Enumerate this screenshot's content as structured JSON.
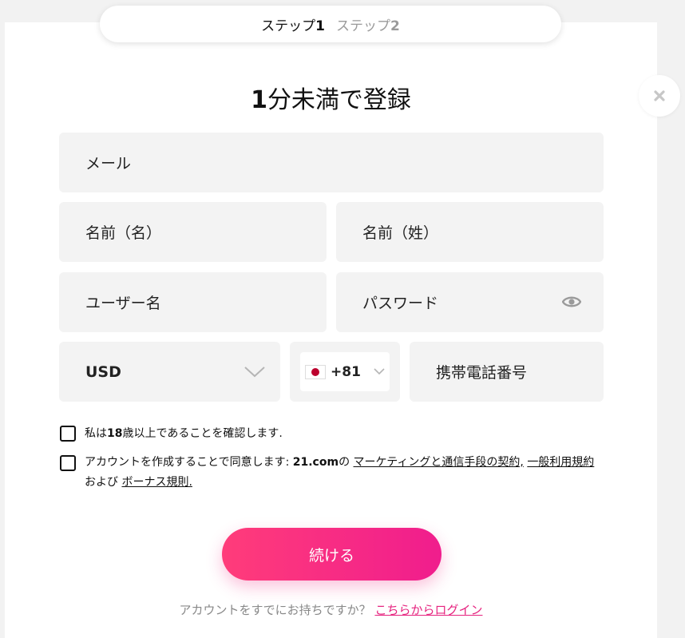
{
  "steps": {
    "step1_label": "ステップ",
    "step1_num": "1",
    "step2_label": "ステップ",
    "step2_num": "2"
  },
  "title": {
    "num": "1",
    "text": "分未満で登録"
  },
  "fields": {
    "email_placeholder": "メール",
    "first_name_placeholder": "名前（名）",
    "last_name_placeholder": "名前（姓）",
    "username_placeholder": "ユーザー名",
    "password_placeholder": "パスワード",
    "currency_value": "USD",
    "country_code": "+81",
    "phone_placeholder": "携帯電話番号"
  },
  "checkboxes": {
    "age_pre": "私は",
    "age_num": "18",
    "age_post": "歳以上であることを確認します.",
    "terms_pre": "アカウントを作成することで同意します: ",
    "terms_brand": "21.com",
    "terms_no": "の ",
    "terms_link1": "マーケティングと通信手段の契約,",
    "terms_link2": "一般利用規約",
    "terms_and": " および ",
    "terms_link3": "ボーナス規則."
  },
  "continue_button": "続ける",
  "login": {
    "prompt": "アカウントをすでにお持ちですか？ ",
    "link": "こちらからログイン"
  },
  "colors": {
    "accent": "#f01d8d",
    "field_bg": "#f3f3f3"
  },
  "icons": {
    "close": "close-icon",
    "eye": "eye-icon",
    "chevron": "chevron-down-icon",
    "flag": "japan-flag-icon"
  }
}
